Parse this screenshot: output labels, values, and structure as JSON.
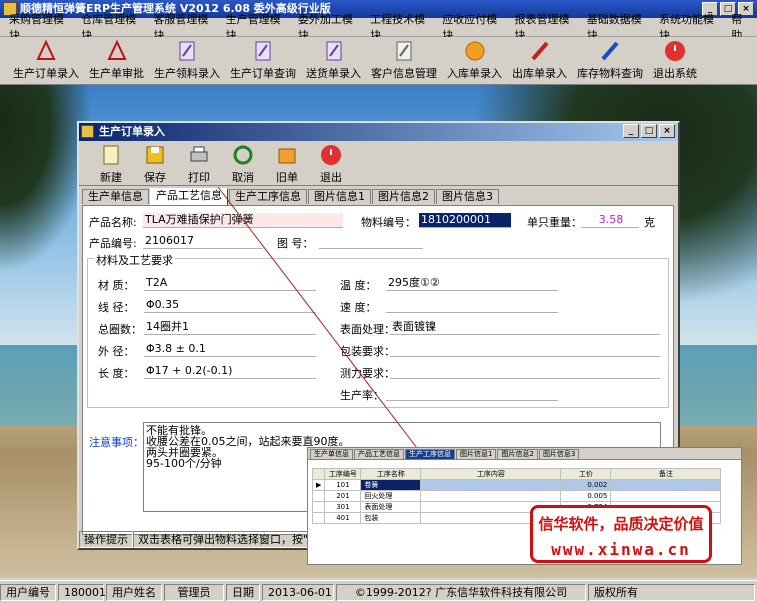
{
  "app": {
    "title": "顺德精恒弹簧ERP生产管理系统  V2012 6.08  委外高级行业版",
    "menus": [
      "采购管理模块",
      "仓库管理模块",
      "客服管理模块",
      "生产管理模块",
      "委外加工模块",
      "工程技术模块",
      "应收应付模块",
      "报表管理模块",
      "基础数据模块",
      "系统功能模块",
      "帮助"
    ],
    "toolbar": [
      "生产订单录入",
      "生产单审批",
      "生产领料录入",
      "生产订单查询",
      "送货单录入",
      "客户信息管理",
      "入库单录入",
      "出库单录入",
      "库存物料查询",
      "退出系统"
    ]
  },
  "child": {
    "title": "生产订单录入",
    "toolbar": [
      "新建",
      "保存",
      "打印",
      "取消",
      "旧单",
      "退出"
    ],
    "tabs": [
      "生产单信息",
      "产品工艺信息",
      "生产工序信息",
      "图片信息1",
      "图片信息2",
      "图片信息3"
    ],
    "form": {
      "product_name_label": "产品名称:",
      "product_name": "TLA万难插保护门弹簧",
      "material_no_label": "物料编号：",
      "material_no": "1810200001",
      "unit_weight_label": "单只重量：",
      "unit_weight": "3.58",
      "unit_weight_unit": "克",
      "product_code_label": "产品编号:",
      "product_code": "2106017",
      "drawing_no_label": "图  号：",
      "drawing_no": "",
      "group_title": "材料及工艺要求",
      "material_label": "材  质：",
      "material": "T2A",
      "wire_dia_label": "线  径：",
      "wire_dia": "Φ0.35",
      "total_turns_label": "总圈数：",
      "total_turns": "14圈并1",
      "outer_dia_label": "外  径：",
      "outer_dia": "Φ3.8 ± 0.1",
      "length_label": "长  度：",
      "length": "Φ17 + 0.2(-0.1)",
      "temp_label": "温  度：",
      "temp": "295度①②",
      "speed_label": "速  度：",
      "speed": "",
      "surface_label": "表面处理：",
      "surface": "表面镀镍",
      "package_label": "包装要求：",
      "package": "",
      "test_label": "测力要求：",
      "test": "",
      "productivity_label": "生产率：",
      "productivity": "",
      "notes_label": "注意事项：",
      "notes": "不能有批锋。\n收腰公差在0.05之间，站起来要直90度。\n两头并圈要紧。\n95-100个/分钟"
    },
    "hint_label": "操作提示",
    "hint_text": "双击表格可弹出物料选择窗口，按\"Del"
  },
  "inset": {
    "tabs": [
      "生产单信息",
      "产品工艺信息",
      "生产工序信息",
      "图片信息1",
      "图片信息2",
      "图片信息3"
    ],
    "headers": [
      "工序编号",
      "工序名称",
      "工序内容",
      "工价",
      "备注"
    ],
    "rows": [
      [
        "101",
        "卷簧",
        "",
        "0.002",
        ""
      ],
      [
        "201",
        "回火处理",
        "",
        "0.005",
        ""
      ],
      [
        "301",
        "表面处理",
        "",
        "0.724",
        ""
      ],
      [
        "401",
        "包装",
        "",
        "",
        ""
      ]
    ]
  },
  "badge": {
    "line1": "信华软件，品质决定价值",
    "line2": "www.xinwa.cn"
  },
  "status": {
    "user_no_label": "用户编号",
    "user_no": "180001",
    "user_name_label": "用户姓名",
    "user_name": "管理员",
    "date_label": "日期",
    "date": "2013-06-01",
    "copyright": "©1999-2012?  广东信华软件科技有限公司",
    "rights": "版权所有"
  }
}
